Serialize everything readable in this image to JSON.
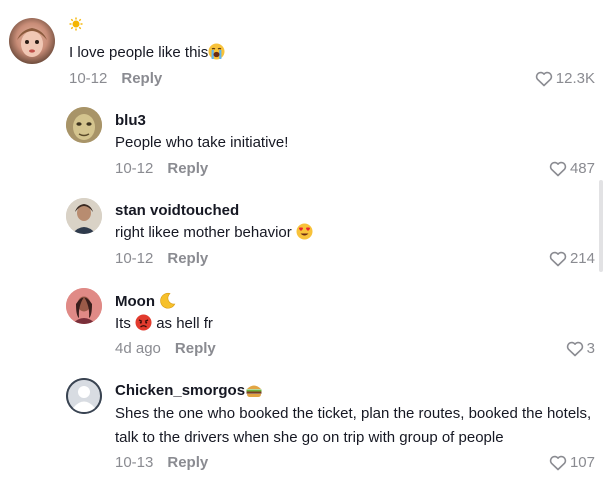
{
  "comments": [
    {
      "username": "",
      "username_emoji": "sun-emoji",
      "text": "I love people like this",
      "text_emoji": "loudly-crying-face-emoji",
      "date": "10-12",
      "reply_label": "Reply",
      "likes": "12.3K",
      "avatar": "doll-avatar"
    },
    {
      "username": "blu3",
      "text": "People who take initiative!",
      "date": "10-12",
      "reply_label": "Reply",
      "likes": "487",
      "avatar": "painted-face-avatar"
    },
    {
      "username": "stan voidtouched",
      "text": "right likee mother behavior",
      "text_emoji": "heart-eyes-emoji",
      "date": "10-12",
      "reply_label": "Reply",
      "likes": "214",
      "avatar": "person-avatar"
    },
    {
      "username": "Moon",
      "username_emoji": "crescent-moon-emoji",
      "text_before": "Its",
      "text_emoji": "angry-face-emoji",
      "text_after": "as hell fr",
      "date": "4d ago",
      "reply_label": "Reply",
      "likes": "3",
      "avatar": "person-avatar"
    },
    {
      "username": "Chicken_smorgos",
      "username_emoji": "burger-emoji",
      "text": "Shes the one who booked the ticket, plan the routes, booked the hotels, talk to the drivers when she go on trip with group of people",
      "date": "10-13",
      "reply_label": "Reply",
      "likes": "107",
      "avatar": "default-user-avatar"
    }
  ],
  "colors": {
    "text_primary": "#161823",
    "text_secondary": "#8a8b91"
  }
}
